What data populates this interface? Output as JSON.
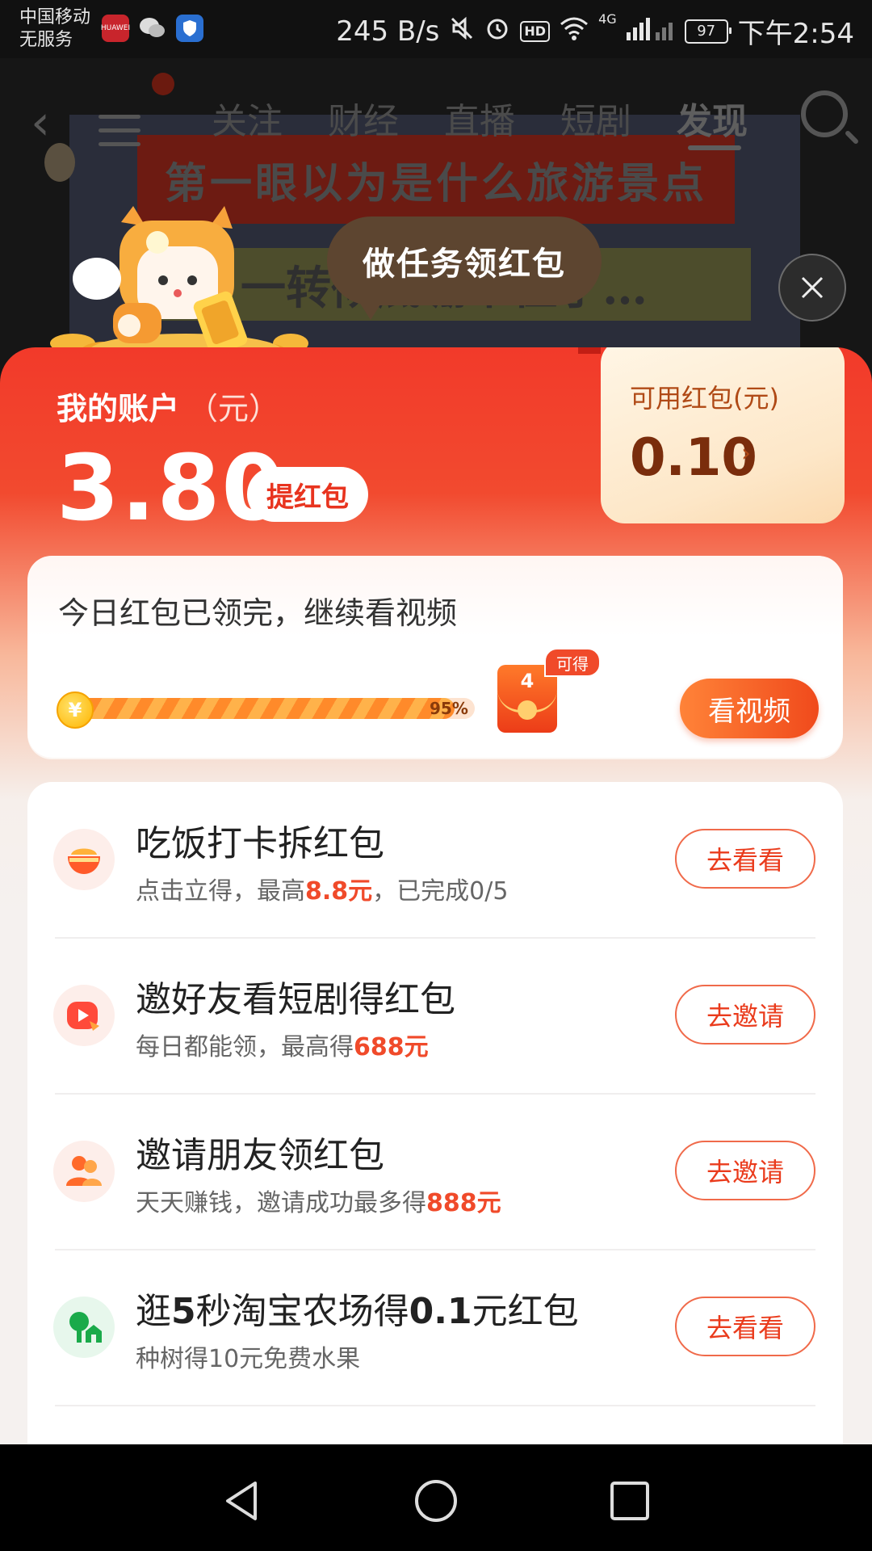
{
  "status_bar": {
    "carrier_line1": "中国移动",
    "carrier_line2": "无服务",
    "app_icons": [
      "huawei-icon",
      "wechat-icon",
      "shield-icon"
    ],
    "huawei_label": "HUAWEI",
    "net_speed": "245 B/s",
    "hd": "HD",
    "network": "4G",
    "battery": "97",
    "time": "下午2:54"
  },
  "background_app": {
    "tabs": [
      "关注",
      "财经",
      "直播",
      "短剧",
      "发现"
    ],
    "active_tab": "发现",
    "video_caption_1": "第一眼以为是什么旅游景点",
    "video_caption_2": "一转彻底绷不住了…"
  },
  "bubble": "做任务领红包",
  "account": {
    "title": "我的账户",
    "unit": "（元）",
    "amount": "3.80",
    "withdraw_label": "提红包"
  },
  "available_redpack": {
    "title": "可用红包(元)",
    "value": "0.10",
    "arrow": "›"
  },
  "progress": {
    "title": "今日红包已领完，继续看视频",
    "percent_label": "95%",
    "percent": 95,
    "coin_symbol": "¥",
    "envelope_count": "4",
    "badge": "可得",
    "button": "看视频"
  },
  "tasks": [
    {
      "icon": "bowl-icon",
      "title": "吃饭打卡拆红包",
      "sub_pre": "点击立得，最高",
      "sub_hl": "8.8元",
      "sub_post": "，已完成0/5",
      "button": "去看看"
    },
    {
      "icon": "video-play-icon",
      "title": "邀好友看短剧得红包",
      "sub_pre": "每日都能领，最高得",
      "sub_hl": "688元",
      "sub_post": "",
      "button": "去邀请"
    },
    {
      "icon": "friends-icon",
      "title": "邀请朋友领红包",
      "sub_pre": "天天赚钱，邀请成功最多得",
      "sub_hl": "888元",
      "sub_post": "",
      "button": "去邀请"
    },
    {
      "icon": "tree-farm-icon",
      "title_pre": "逛",
      "title_b1": "5",
      "title_mid": "秒淘宝农场得",
      "title_b2": "0.1",
      "title_post": "元红包",
      "sub_pre": "种树得10元免费水果",
      "sub_hl": "",
      "sub_post": "",
      "button": "去看看"
    }
  ],
  "colors": {
    "primary_red": "#f23a2a",
    "accent_orange": "#ff8338",
    "highlight": "#f04a2a"
  }
}
